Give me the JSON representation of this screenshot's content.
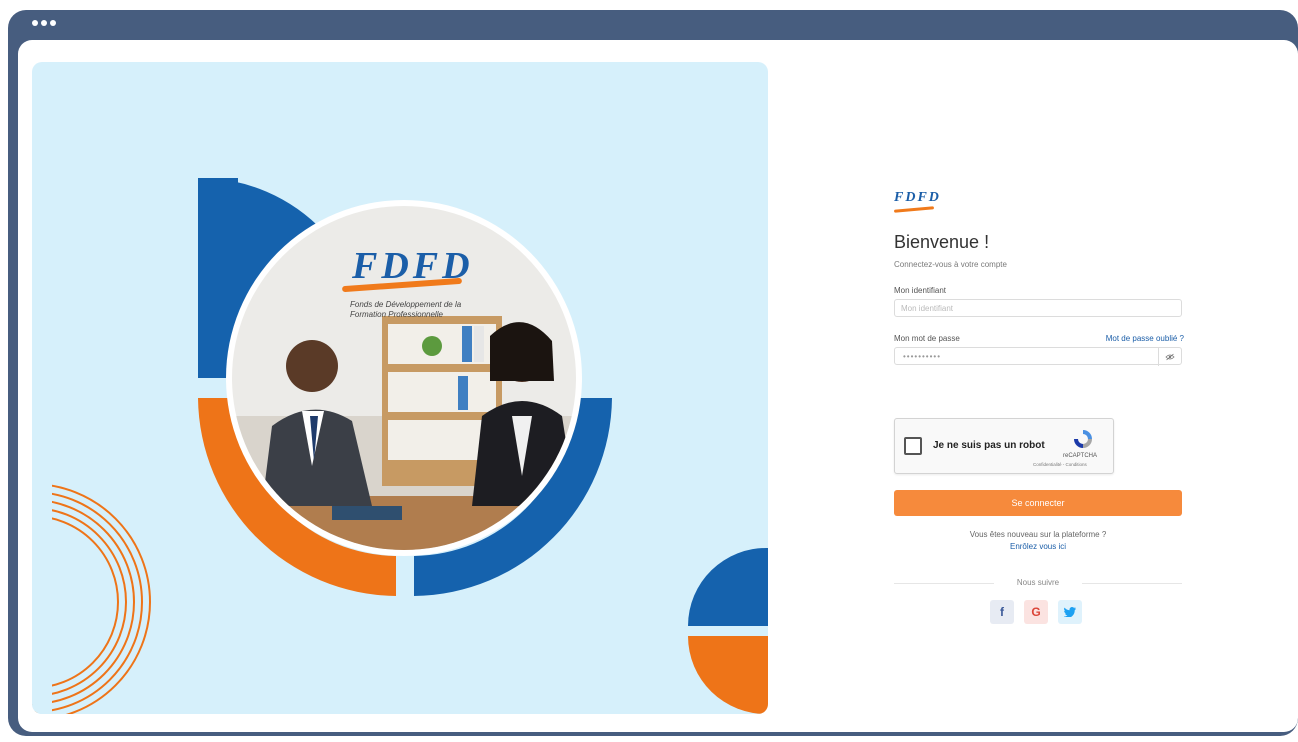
{
  "window": {
    "title_dots": 3
  },
  "hero": {
    "logo_text": "FDFD",
    "tagline": "Fonds de Développement de la Formation Professionnelle"
  },
  "login": {
    "brand_text": "FDFD",
    "title": "Bienvenue !",
    "subtitle": "Connectez-vous à votre compte",
    "username_label": "Mon identifiant",
    "username_placeholder": "Mon identifiant",
    "password_label": "Mon mot de passe",
    "password_mask": "••••••••••",
    "forgot_link": "Mot de passe oublié ?",
    "captcha_label": "Je ne suis pas un robot",
    "captcha_brand": "reCAPTCHA",
    "captcha_links": "Confidentialité - Conditions",
    "submit_label": "Se connecter",
    "new_user_text": "Vous êtes nouveau sur la plateforme ?",
    "enroll_link": "Enrôlez vous ici",
    "follow_label": "Nous suivre",
    "social": [
      {
        "name": "facebook",
        "glyph": "f"
      },
      {
        "name": "google",
        "glyph": "G"
      },
      {
        "name": "twitter",
        "glyph": "🐦"
      }
    ]
  },
  "colors": {
    "frame": "#475d7f",
    "hero_bg": "#d6f0fb",
    "brand_blue": "#1b5ea8",
    "brand_orange": "#f07a1b",
    "button": "#f68a3c"
  }
}
